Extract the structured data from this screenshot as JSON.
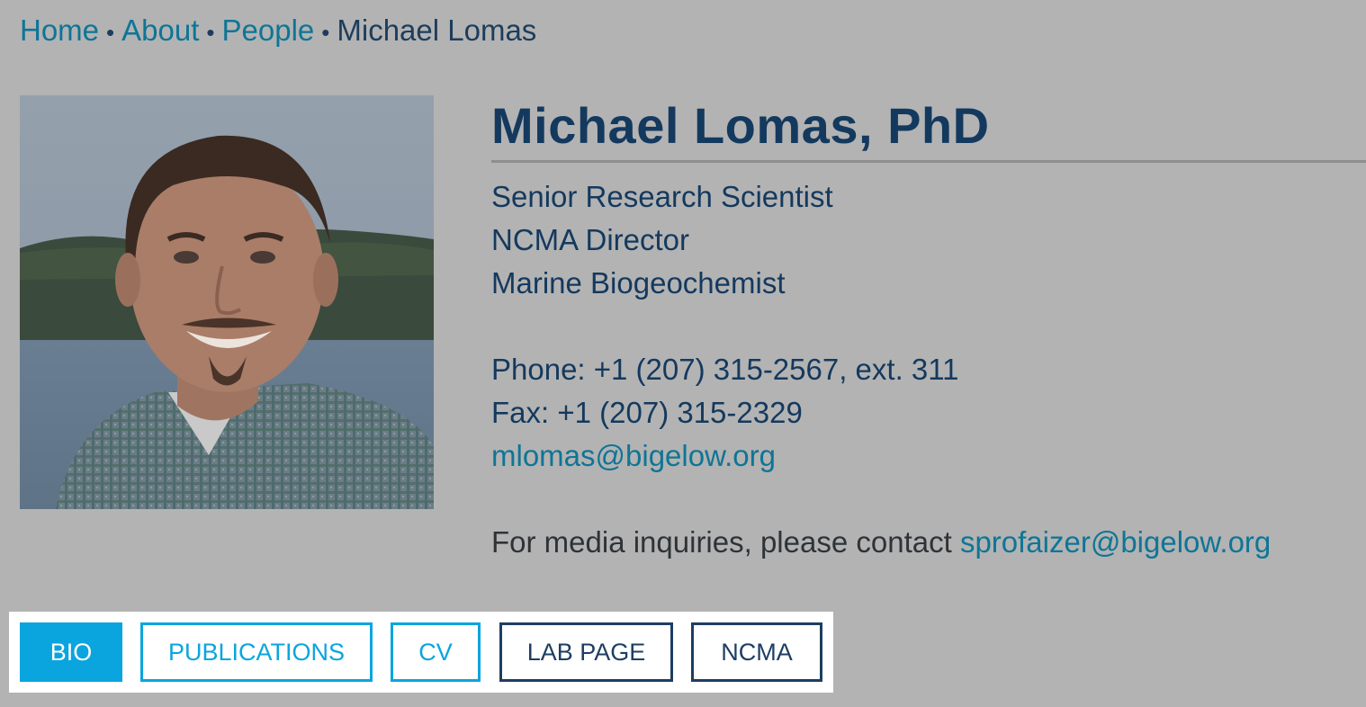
{
  "breadcrumb": {
    "items": [
      "Home",
      "About",
      "People"
    ],
    "separator": "•",
    "current": "Michael Lomas"
  },
  "profile": {
    "name": "Michael Lomas, PhD",
    "titles": [
      "Senior Research Scientist",
      "NCMA Director",
      "Marine Biogeochemist"
    ],
    "phone": "Phone: +1 (207) 315-2567, ext. 311",
    "fax": "Fax: +1 (207) 315-2329",
    "email": "mlomas@bigelow.org",
    "media_text": "For media inquiries, please contact ",
    "media_email": "sprofaizer@bigelow.org"
  },
  "tabs": [
    {
      "label": "BIO",
      "active": true
    },
    {
      "label": "PUBLICATIONS"
    },
    {
      "label": "CV"
    },
    {
      "label": "LAB PAGE"
    },
    {
      "label": "NCMA"
    }
  ],
  "colors": {
    "background": "#b3b3b3",
    "link": "#0f7596",
    "heading": "#14395e",
    "tab_active": "#0aa5de",
    "tab_dark_border": "#1d3e63"
  }
}
